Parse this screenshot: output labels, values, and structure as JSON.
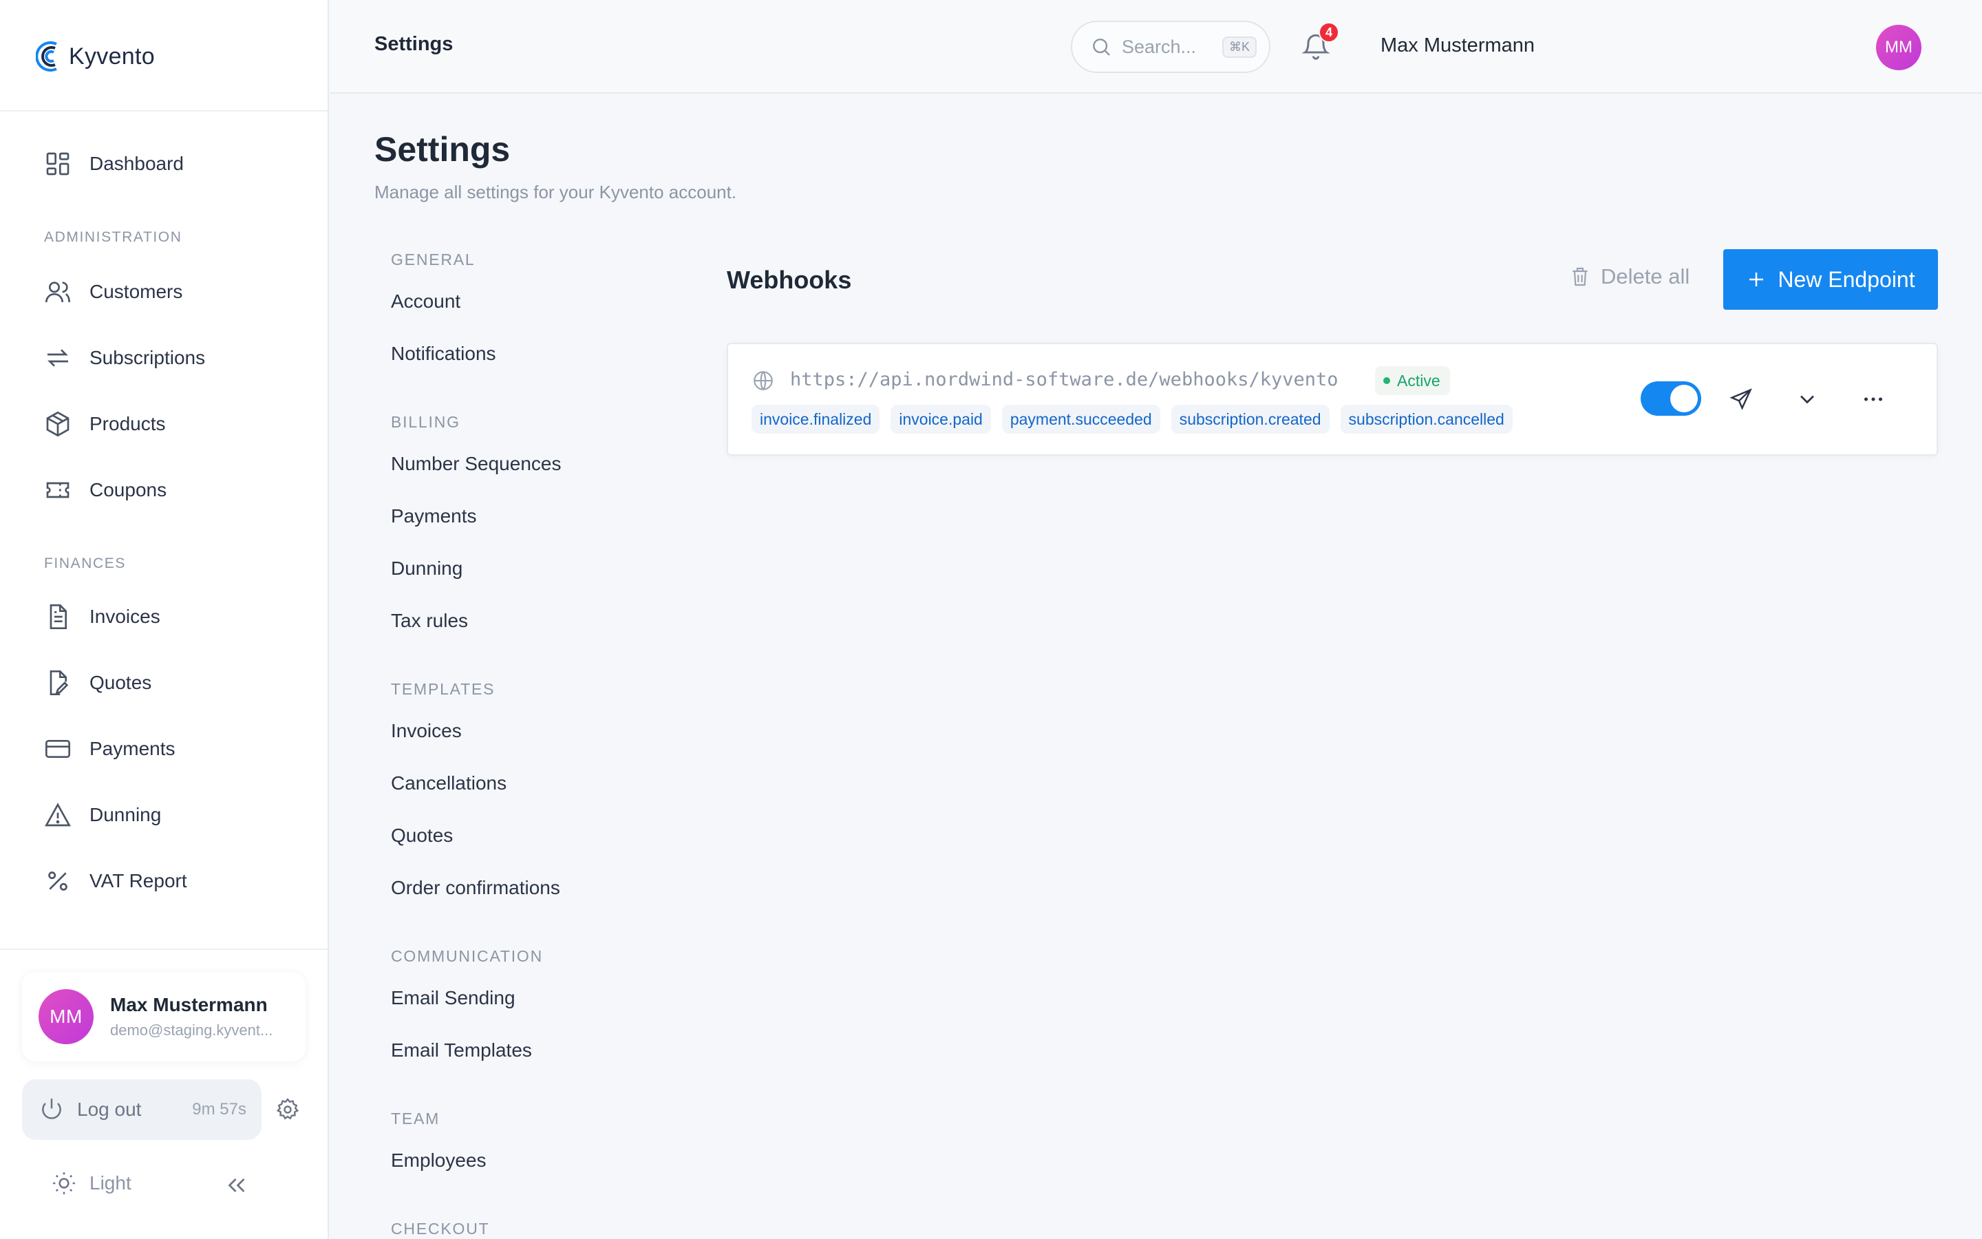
{
  "app": {
    "logo_text": "Kyvento"
  },
  "sidebar": {
    "dashboard": "Dashboard",
    "sections": {
      "administration": "ADMINISTRATION",
      "finances": "FINANCES"
    },
    "administration_items": [
      "Customers",
      "Subscriptions",
      "Products",
      "Coupons"
    ],
    "finance_items": [
      "Invoices",
      "Quotes",
      "Payments",
      "Dunning",
      "VAT Report"
    ],
    "user": {
      "initials": "MM",
      "name": "Max Mustermann",
      "email": "demo@staging.kyvent..."
    },
    "logout": {
      "label": "Log out",
      "timer": "9m 57s"
    },
    "theme": "Light"
  },
  "topbar": {
    "title": "Settings",
    "search_placeholder": "Search...",
    "search_shortcut": "⌘K",
    "notifications_count": "4",
    "user_name": "Max Mustermann",
    "user_initials": "MM"
  },
  "page": {
    "title": "Settings",
    "subtitle": "Manage all settings for your Kyvento account."
  },
  "settings_nav": {
    "general": {
      "title": "GENERAL",
      "items": [
        "Account",
        "Notifications"
      ]
    },
    "billing": {
      "title": "BILLING",
      "items": [
        "Number Sequences",
        "Payments",
        "Dunning",
        "Tax rules"
      ]
    },
    "templates": {
      "title": "TEMPLATES",
      "items": [
        "Invoices",
        "Cancellations",
        "Quotes",
        "Order confirmations"
      ]
    },
    "communication": {
      "title": "COMMUNICATION",
      "items": [
        "Email Sending",
        "Email Templates"
      ]
    },
    "team": {
      "title": "TEAM",
      "items": [
        "Employees"
      ]
    },
    "checkout": {
      "title": "CHECKOUT"
    }
  },
  "webhooks": {
    "title": "Webhooks",
    "delete_all": "Delete all",
    "new_endpoint": "New Endpoint",
    "endpoints": [
      {
        "url": "https://api.nordwind-software.de/webhooks/kyvento",
        "status": "Active",
        "enabled": true,
        "events": [
          "invoice.finalized",
          "invoice.paid",
          "payment.succeeded",
          "subscription.created",
          "subscription.cancelled"
        ]
      }
    ]
  },
  "colors": {
    "accent": "#1587f0",
    "active": "#16a36a",
    "badge": "#ef2b3a",
    "avatar": "#d244cc"
  }
}
